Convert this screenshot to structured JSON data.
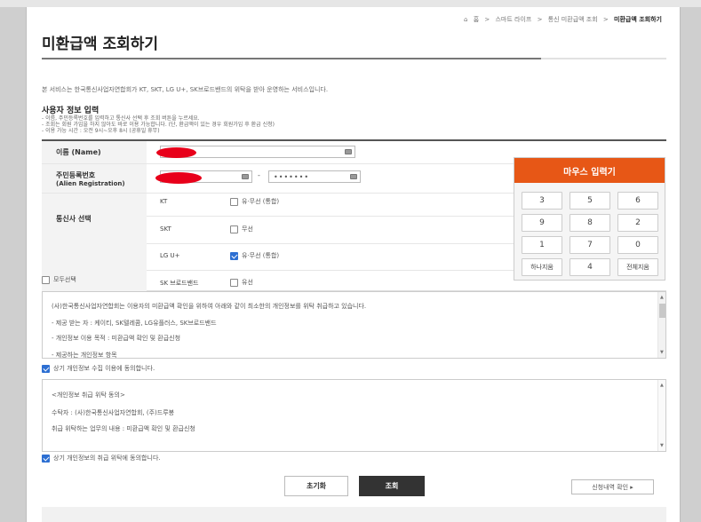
{
  "breadcrumb": {
    "home_icon": "home-icon",
    "items": [
      "홈",
      "스마트 라이프",
      "통신 미환급액 조회",
      "미환급액 조회하기"
    ],
    "separator": ">"
  },
  "page_title": "미환급액 조회하기",
  "intro": "본 서비스는 한국통신사업자연합회가 KT, SKT, LG U+, SK브로드밴드의 위탁을 받아 운영하는 서비스입니다.",
  "section": {
    "title": "사용자 정보 입력",
    "notes": [
      "- 이름, 주민등록번호를 입력하고 통신사 선택 후 조회 버튼을 누르세요.",
      "- 조회는 회원 가입을 하지 않아도 바로 이용 가능합니다. (단, 환급액이 있는 경우 회원가입 후 환급 신청)",
      "- 이용 가능 시간 : 오전 9시~오후 8시 (공휴일 휴무)"
    ]
  },
  "form": {
    "name_label": "이름 (Name)",
    "rrn_label": "주민등록번호",
    "rrn_sublabel": "(Alien Registration)",
    "rrn_dash": "-",
    "rrn_back_value": "•••••••",
    "carrier_label": "통신사 선택",
    "select_all_label": "모두선택",
    "select_all_checked": false,
    "carriers": [
      {
        "name": "KT",
        "option": "유·무선 (통합)",
        "checked": false
      },
      {
        "name": "SKT",
        "option": "무선",
        "checked": false
      },
      {
        "name": "LG U+",
        "option": "유·무선 (통합)",
        "checked": true
      },
      {
        "name": "SK 브로드밴드",
        "option": "유선",
        "checked": false
      }
    ]
  },
  "keypad": {
    "title": "마우스 입력기",
    "keys": [
      [
        "3",
        "5",
        "6"
      ],
      [
        "9",
        "8",
        "2"
      ],
      [
        "1",
        "7",
        "0"
      ],
      [
        "하나지움",
        "4",
        "전체지움"
      ]
    ]
  },
  "privacy1": {
    "lines": [
      "(사)한국통신사업자연합회는 이용자의 미환급액 확인을 위하여 아래와 같이 최소한의 개인정보를 위탁 취급하고 있습니다.",
      "- 제공 받는 자 : 케이티, SK텔레콤, LG유플러스, SK브로드밴드",
      "- 개인정보 이용 목적 : 미환급액 확인 및 환급신청",
      "- 제공하는 개인정보 항목"
    ],
    "agree_label": "상기 개인정보 수집 이용에 동의합니다.",
    "agree_checked": true
  },
  "privacy2": {
    "lines": [
      "<개인정보 취급 위탁 동의>",
      "수탁자 : (사)한국통신사업자연합회, (주)드루봉",
      "취급 위탁하는 업무의 내용 : 미환급액 확인 및 환급신청"
    ],
    "agree_label": "상기 개인정보의 취급 위탁에 동의합니다.",
    "agree_checked": true
  },
  "buttons": {
    "reset": "초기화",
    "search": "조회",
    "history": "신청내역 확인 ▸"
  },
  "colors": {
    "keypad_header": "#e75716",
    "checkbox_on": "#2d6fd2",
    "redaction": "#e8001a",
    "search_button": "#333333"
  }
}
